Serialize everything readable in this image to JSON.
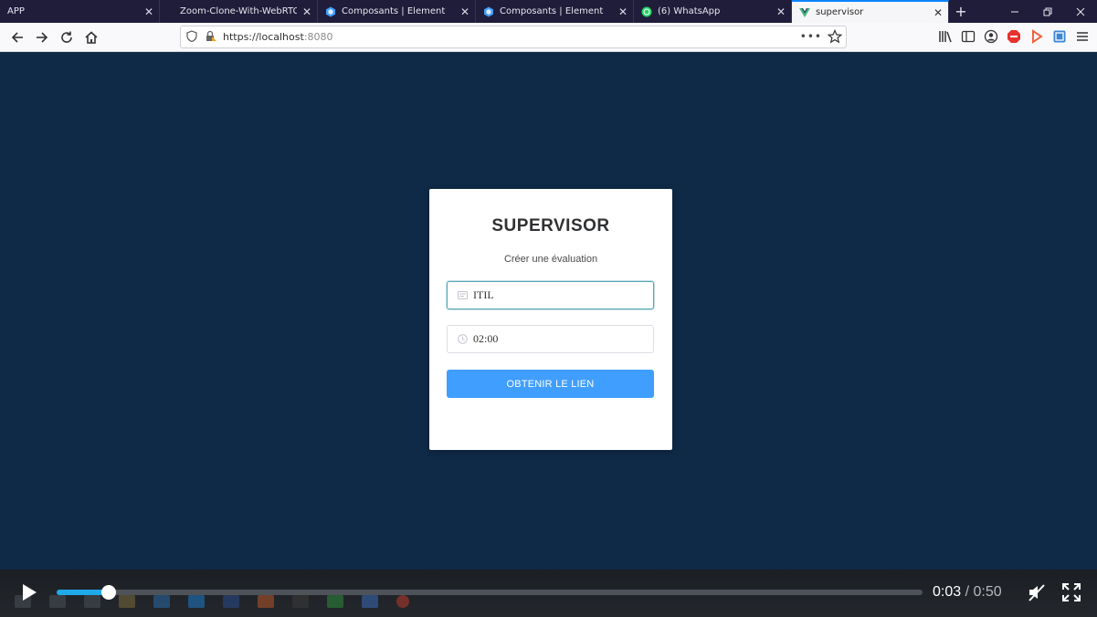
{
  "browser": {
    "tabs": [
      {
        "label": "APP",
        "close": "✕",
        "favicon": "none",
        "active": false
      },
      {
        "label": "Zoom-Clone-With-WebRTC/p",
        "close": "✕",
        "favicon": "none",
        "active": false
      },
      {
        "label": "Composants | Element",
        "close": "✕",
        "favicon": "element-icon",
        "active": false
      },
      {
        "label": "Composants | Element",
        "close": "✕",
        "favicon": "element-icon",
        "active": false
      },
      {
        "label": "(6) WhatsApp",
        "close": "✕",
        "favicon": "whatsapp-icon",
        "active": false
      },
      {
        "label": "supervisor",
        "close": "✕",
        "favicon": "vue-icon",
        "active": true
      }
    ],
    "new_tab": "+",
    "url_host": "https://localhost",
    "url_port": ":8080",
    "menu_dots": "•••"
  },
  "form": {
    "title": "SUPERVISOR",
    "subtitle": "Créer une évaluation",
    "field1_value": "ITIL",
    "field2_value": "02:00",
    "submit_label": "OBTENIR LE LIEN"
  },
  "video": {
    "current_time": "0:03",
    "separator": "/",
    "total_time": "0:50",
    "progress_fraction": 0.06
  },
  "colors": {
    "page_background": "#0f2a47",
    "primary_button": "#409eff",
    "progress_fill": "#1fa9e8",
    "tabbar": "#1f1d3a"
  }
}
